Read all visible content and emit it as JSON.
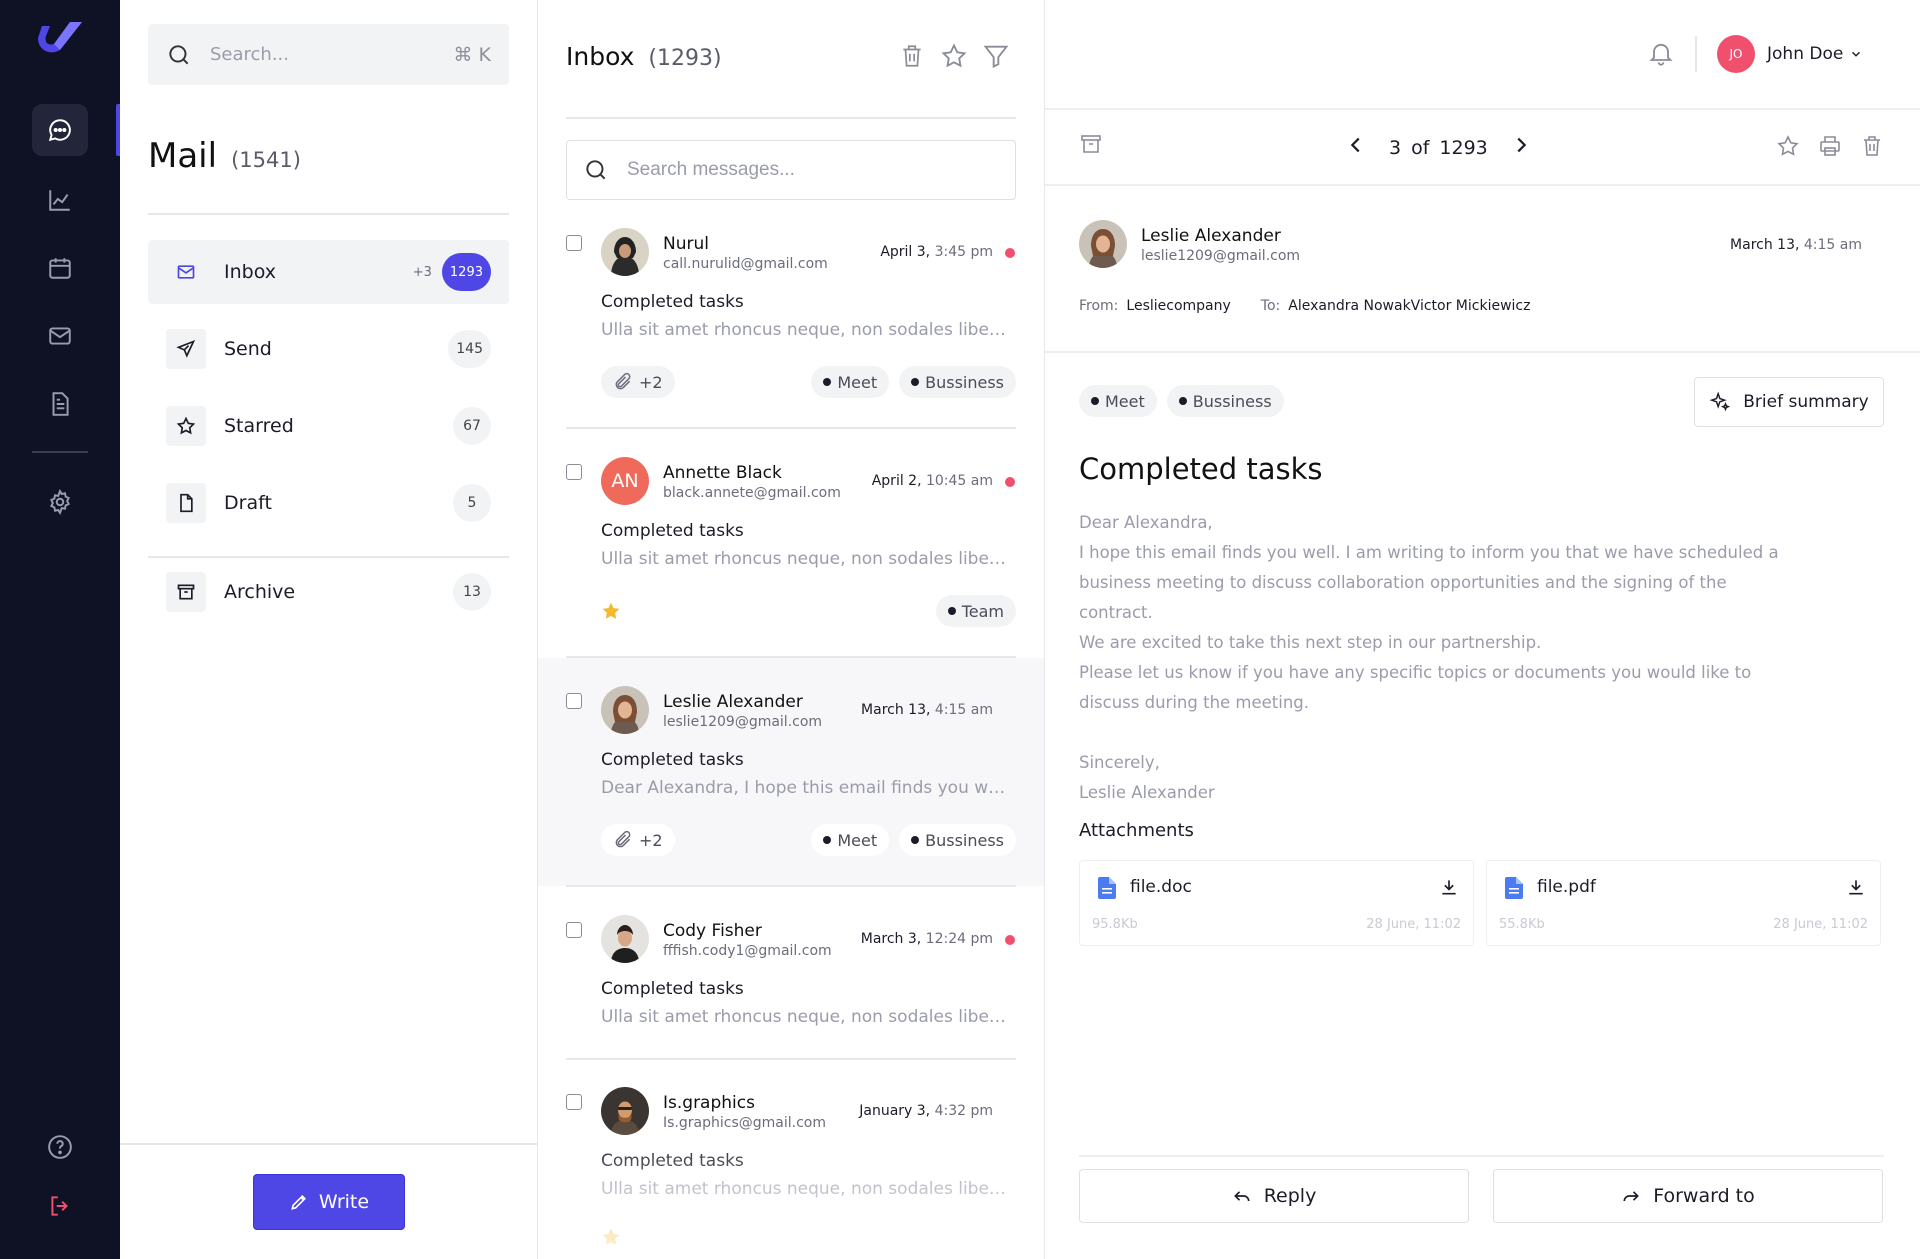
{
  "search": {
    "placeholder": "Search...",
    "shortcut": "⌘ K"
  },
  "mail": {
    "title": "Mail",
    "count": "(1541)"
  },
  "folders": [
    {
      "label": "Inbox",
      "plus": "+3",
      "count": "1293"
    },
    {
      "label": "Send",
      "count": "145"
    },
    {
      "label": "Starred",
      "count": "67"
    },
    {
      "label": "Draft",
      "count": "5"
    },
    {
      "label": "Archive",
      "count": "13"
    }
  ],
  "write_label": "Write",
  "inbox": {
    "title": "Inbox",
    "count": "(1293)",
    "search_placeholder": "Search messages..."
  },
  "messages": [
    {
      "name": "Nurul",
      "email": "call.nurulid@gmail.com",
      "date": "April 3,",
      "time": "3:45 pm",
      "subject": "Completed tasks",
      "preview": "Ulla sit amet rhoncus neque, non sodales libero. In hac habitasse platea",
      "attach": "+2",
      "tags": [
        "Meet",
        "Bussiness"
      ]
    },
    {
      "name": "Annette Black",
      "initials": "AN",
      "email": "black.annete@gmail.com",
      "date": "April 2,",
      "time": "10:45 am",
      "subject": "Completed tasks",
      "preview": "Ulla sit amet rhoncus neque, non sodales libero. In hac habitasse platea",
      "tags": [
        "Team"
      ]
    },
    {
      "name": "Leslie Alexander",
      "email": "leslie1209@gmail.com",
      "date": "March 13,",
      "time": "4:15 am",
      "subject": "Completed tasks",
      "preview": "Dear Alexandra, I hope this email finds you well. I am writing to inform",
      "attach": "+2",
      "tags": [
        "Meet",
        "Bussiness"
      ]
    },
    {
      "name": "Cody Fisher",
      "email": "fffish.cody1@gmail.com",
      "date": "March 3,",
      "time": "12:24 pm",
      "subject": "Completed tasks",
      "preview": "Ulla sit amet rhoncus neque, non sodales libero. In hac habitasse platea"
    },
    {
      "name": "Is.graphics",
      "email": "Is.graphics@gmail.com",
      "date": "January 3,",
      "time": "4:32 pm",
      "subject": "Completed tasks",
      "preview": "Ulla sit amet rhoncus neque, non sodales libero. In hac habitasse platea"
    }
  ],
  "user": {
    "initials": "JO",
    "name": "John Doe"
  },
  "pager": {
    "current": "3",
    "of": "of",
    "total": "1293"
  },
  "reader": {
    "sender_name": "Leslie Alexander",
    "sender_email": "leslie1209@gmail.com",
    "date": "March 13,",
    "time": "4:15 am",
    "from_label": "From:",
    "from": "Lesliecompany",
    "to_label": "To:",
    "to": "Alexandra NowakVictor Mickiewicz",
    "tags": [
      "Meet",
      "Bussiness"
    ],
    "brief_label": "Brief summary",
    "subject": "Completed tasks",
    "body": [
      "Dear Alexandra,",
      "I hope this email finds you well. I am writing to inform you that we have scheduled a",
      "business meeting to discuss collaboration opportunities and the signing of the contract.",
      "We are excited to take this next step in our partnership.",
      "Please let us know if you have any specific topics or documents you would like to",
      "discuss during the meeting.",
      "",
      "Sincerely,",
      "Leslie Alexander"
    ],
    "attachments_title": "Attachments",
    "attachments": [
      {
        "name": "file.doc",
        "size": "95.8Kb",
        "date": "28 June, 11:02"
      },
      {
        "name": "file.pdf",
        "size": "55.8Kb",
        "date": "28 June, 11:02"
      }
    ],
    "reply_label": "Reply",
    "forward_label": "Forward to"
  },
  "colors": {
    "accent": "#4e47e5",
    "rail": "#0f1225",
    "unread": "#f0506e",
    "star": "#f5b82e"
  }
}
